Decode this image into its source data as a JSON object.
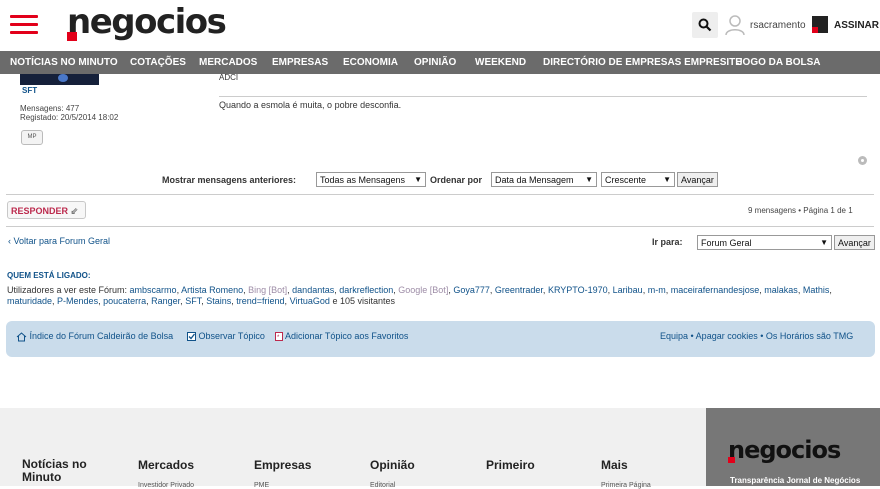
{
  "header": {
    "logo": "negocios",
    "user_name": "rsacramento",
    "subscribe_label": "ASSINAR"
  },
  "nav": [
    "NOTÍCIAS NO MINUTO",
    "COTAÇÕES",
    "MERCADOS",
    "EMPRESAS",
    "ECONOMIA",
    "OPINIÃO",
    "WEEKEND",
    "DIRECTÓRIO DE EMPRESAS EMPRESITE",
    "JOGO DA BOLSA"
  ],
  "post": {
    "author": "SFT",
    "messages_label": "Mensagens:",
    "messages_count": "477",
    "registered_label": "Registado:",
    "registered_date": "20/5/2014 18:02",
    "pm_label": "MP",
    "body_tail": "ADCI",
    "signature": "Quando a esmola é muita, o pobre desconfia."
  },
  "filter": {
    "show_label": "Mostrar mensagens anteriores:",
    "show_value": "Todas as Mensagens",
    "order_label": "Ordenar por",
    "order_value": "Data da Mensagem",
    "direction_value": "Crescente",
    "go_label": "Avançar"
  },
  "reply": {
    "reply_label": "RESPONDER",
    "pagination": "9 mensagens • Página 1 de 1"
  },
  "jump": {
    "back_link": "Voltar para Forum Geral",
    "label": "Ir para:",
    "value": "Forum Geral",
    "go_label": "Avançar"
  },
  "online": {
    "title": "QUEM ESTÁ LIGADO:",
    "prefix": "Utilizadores a ver este Fórum:",
    "users": [
      "ambscarmo",
      "Artista Romeno",
      "Bing [Bot]",
      "dandantas",
      "darkreflection",
      "Google [Bot]",
      "Goya777",
      "Greentrader",
      "KRYPTO-1970",
      "Laribau",
      "m-m",
      "maceirafernandesjose",
      "malakas",
      "Mathis",
      "maturidade",
      "P-Mendes",
      "poucaterra",
      "Ranger",
      "SFT",
      "Stains",
      "trend=friend",
      "VirtuaGod"
    ],
    "suffix": "e 105 visitantes"
  },
  "footer_nav": {
    "index": "Índice do Fórum Caldeirão de Bolsa",
    "watch": "Observar Tópico",
    "favorite": "Adicionar Tópico aos Favoritos",
    "right": "Equipa • Apagar cookies • Os Horários são TMG"
  },
  "site_footer": {
    "columns": [
      "Notícias no Minuto",
      "Mercados",
      "Empresas",
      "Opinião",
      "Primeiro",
      "Mais"
    ],
    "subs": [
      "Investidor Privado",
      "PME",
      "Editorial",
      "Primeira Página"
    ],
    "brand_logo": "negocios",
    "brand_text": "Transparência Jornal de Negócios"
  }
}
